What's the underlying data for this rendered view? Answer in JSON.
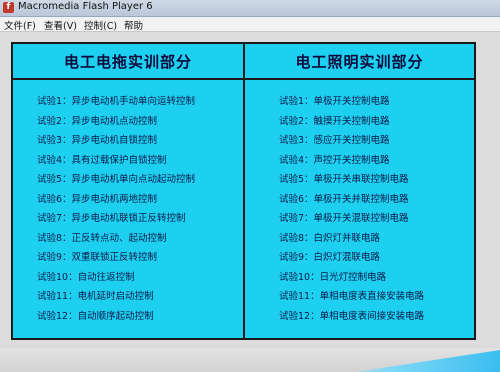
{
  "window": {
    "title": "Macromedia Flash Player 6",
    "icon": "flash-app-icon"
  },
  "menu": {
    "items": [
      "文件(F)",
      "查看(V)",
      "控制(C)",
      "帮助"
    ]
  },
  "colors": {
    "panel_bg": "#1ed0f0",
    "border": "#1a1a1a",
    "text": "#0b1a4a"
  },
  "left": {
    "heading": "电工电拖实训部分",
    "items": [
      "试验1：异步电动机手动单向运转控制",
      "试验2：异步电动机点动控制",
      "试验3：异步电动机自锁控制",
      "试验4：具有过载保护自锁控制",
      "试验5：异步电动机单向点动起动控制",
      "试验6：异步电动机两地控制",
      "试验7：异步电动机联锁正反转控制",
      "试验8：正反转点动、起动控制",
      "试验9：双重联锁正反转控制",
      "试验10：自动往返控制",
      "试验11：电机延时启动控制",
      "试验12：自动顺序起动控制"
    ]
  },
  "right": {
    "heading": "电工照明实训部分",
    "items": [
      "试验1：单极开关控制电路",
      "试验2：触摸开关控制电路",
      "试验3：感应开关控制电路",
      "试验4：声控开关控制电路",
      "试验5：单极开关串联控制电路",
      "试验6：单极开关并联控制电路",
      "试验7：单极开关混联控制电路",
      "试验8：白炽灯并联电路",
      "试验9：白炽灯混联电路",
      "试验10：日光灯控制电路",
      "试验11：单相电度表直接安装电路",
      "试验12：单相电度表间接安装电路"
    ]
  }
}
